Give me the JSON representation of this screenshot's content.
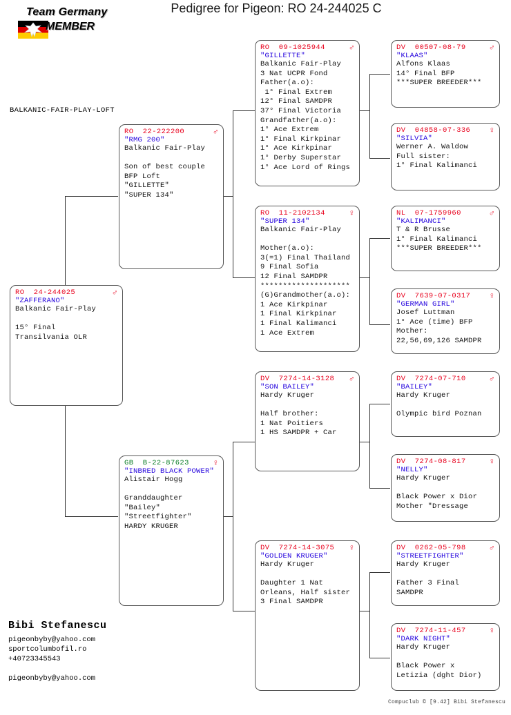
{
  "header": {
    "title": "Pedigree for Pigeon: RO  24-244025 C",
    "logo_line1": "Team Germany",
    "logo_line2": "MEMBER",
    "loft_name": "BALKANIC-FAIR-PLAY-LOFT"
  },
  "footer": {
    "owner": "Bibi Stefanescu",
    "email": "pigeonbyby@yahoo.com",
    "website": "sportcolumbofil.ro",
    "phone": "+40723345543",
    "email2": "pigeonbyby@yahoo.com",
    "credit": "Compuclub © [9.42]  Bibi Stefanescu"
  },
  "colors": {
    "ring": "#e8001c",
    "ring_gb": "#0a7d26",
    "name": "#2200dd",
    "text": "#111111",
    "border": "#555555"
  },
  "subject": {
    "ring": "RO  24-244025",
    "sex": "male",
    "sex_glyph": "♂",
    "name": "\"ZAFFERANO\"",
    "lines": [
      "Balkanic Fair-Play",
      "",
      "15° Final",
      "Transilvania OLR"
    ]
  },
  "generation1": [
    {
      "ring": "RO  22-222200",
      "sex": "male",
      "sex_glyph": "♂",
      "ring_color": "#e8001c",
      "name": "\"RMG 200\"",
      "lines": [
        "Balkanic Fair-Play",
        "",
        "Son of best couple",
        "BFP Loft",
        "\"GILLETTE\"",
        "\"SUPER 134\""
      ]
    },
    {
      "ring": "GB  B-22-87623",
      "sex": "female",
      "sex_glyph": "♀",
      "ring_color": "#0a7d26",
      "name": "\"INBRED BLACK POWER\"",
      "lines": [
        "Alistair Hogg",
        "",
        "Granddaughter",
        "\"Bailey\"",
        "\"Streetfighter\"",
        "HARDY KRUGER"
      ]
    }
  ],
  "generation2": [
    {
      "ring": "RO  09-1025944",
      "sex": "male",
      "sex_glyph": "♂",
      "name": "\"GILLETTE\"",
      "lines": [
        "Balkanic Fair-Play",
        "3 Nat UCPR Fond",
        "Father(a.o):",
        " 1° Final Extrem",
        "12° Final SAMDPR",
        "37° Final Victoria",
        "Grandfather(a.o):",
        "1° Ace Extrem",
        "1° Final Kirkpinar",
        "1° Ace Kirkpinar",
        "1° Derby Superstar",
        "1° Ace Lord of Rings"
      ]
    },
    {
      "ring": "RO  11-2102134",
      "sex": "female",
      "sex_glyph": "♀",
      "name": "\"SUPER 134\"",
      "lines": [
        "Balkanic Fair-Play",
        "",
        "Mother(a.o):",
        "3(=1) Final Thailand",
        "9 Final Sofia",
        "12 Final SAMDPR",
        "********************",
        "(G)Grandmother(a.o):",
        "1 Ace Kirkpinar",
        "1 Final Kirkpinar",
        "1 Final Kalimanci",
        "1 Ace Extrem"
      ]
    },
    {
      "ring": "DV  7274-14-3128",
      "sex": "male",
      "sex_glyph": "♂",
      "name": "\"SON BAILEY\"",
      "lines": [
        "Hardy Kruger",
        "",
        "Half brother:",
        "1 Nat Poitiers",
        "1 HS SAMDPR + Car"
      ]
    },
    {
      "ring": "DV  7274-14-3075",
      "sex": "female",
      "sex_glyph": "♀",
      "name": "\"GOLDEN KRUGER\"",
      "lines": [
        "Hardy Kruger",
        "",
        "Daughter 1 Nat",
        "Orleans, Half sister",
        "3 Final SAMDPR"
      ]
    }
  ],
  "generation3": [
    {
      "ring": "DV  00507-08-79",
      "sex": "male",
      "sex_glyph": "♂",
      "name": "\"KLAAS\"",
      "lines": [
        "Alfons Klaas",
        "14° Final BFP",
        "***SUPER BREEDER***"
      ]
    },
    {
      "ring": "DV  04858-07-336",
      "sex": "female",
      "sex_glyph": "♀",
      "name": "\"SILVIA\"",
      "lines": [
        "Werner A. Waldow",
        "Full sister:",
        "1° Final Kalimanci"
      ]
    },
    {
      "ring": "NL  07-1759960",
      "sex": "male",
      "sex_glyph": "♂",
      "name": "\"KALIMANCI\"",
      "lines": [
        "T & R Brusse",
        "1° Final Kalimanci",
        "***SUPER BREEDER***"
      ]
    },
    {
      "ring": "DV  7639-07-0317",
      "sex": "female",
      "sex_glyph": "♀",
      "name": "\"GERMAN GIRL\"",
      "lines": [
        "Josef Luttman",
        "1° Ace (time) BFP",
        "Mother:",
        "22,56,69,126 SAMDPR"
      ]
    },
    {
      "ring": "DV  7274-07-710",
      "sex": "male",
      "sex_glyph": "♂",
      "name": "\"BAILEY\"",
      "lines": [
        "Hardy Kruger",
        "",
        "Olympic bird Poznan"
      ]
    },
    {
      "ring": "DV  7274-08-817",
      "sex": "female",
      "sex_glyph": "♀",
      "name": "\"NELLY\"",
      "lines": [
        "Hardy Kruger",
        "",
        "Black Power x Dior",
        "Mother \"Dressage"
      ]
    },
    {
      "ring": "DV  0262-05-798",
      "sex": "male",
      "sex_glyph": "♂",
      "name": "\"STREETFIGHTER\"",
      "lines": [
        "Hardy Kruger",
        "",
        "Father 3 Final",
        "SAMDPR"
      ]
    },
    {
      "ring": "DV  7274-11-457",
      "sex": "female",
      "sex_glyph": "♀",
      "name": "\"DARK NIGHT\"",
      "lines": [
        "Hardy Kruger",
        "",
        "Black Power x",
        "Letizia (dght Dior)"
      ]
    }
  ]
}
